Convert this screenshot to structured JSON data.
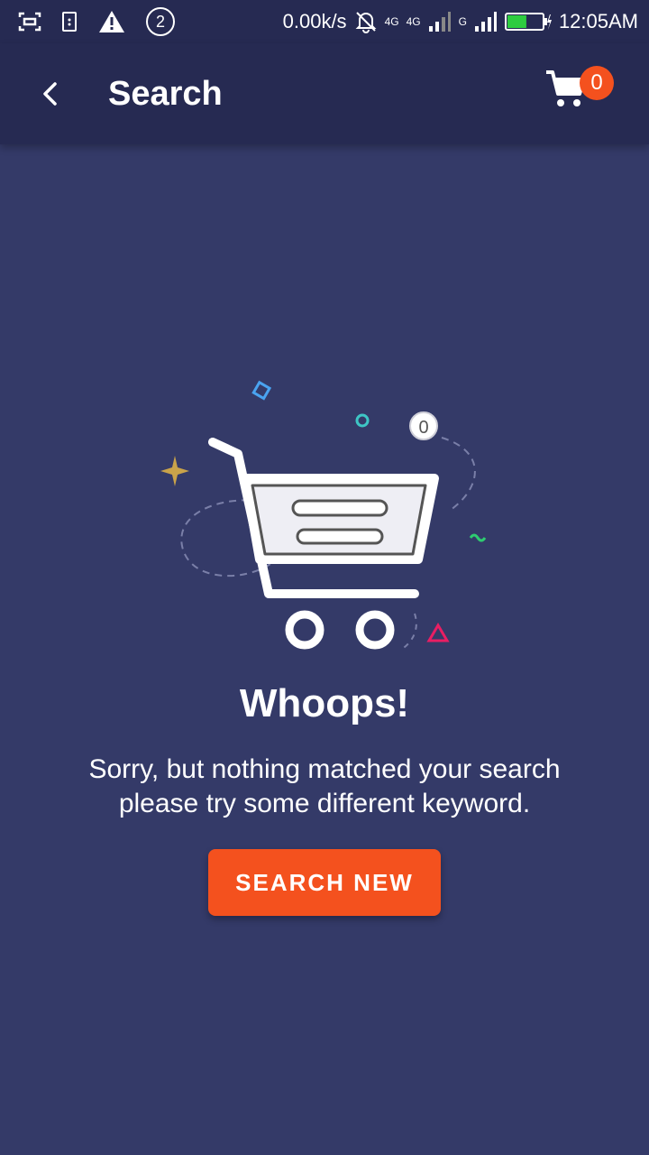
{
  "status_bar": {
    "network_speed": "0.00k/s",
    "notification_count": "2",
    "net_label_1": "4G",
    "net_label_2": "4G",
    "net_label_3": "G",
    "time": "12:05AM",
    "battery_level": 0.55
  },
  "app_bar": {
    "title": "Search",
    "cart_count": "0"
  },
  "illustration": {
    "coin_label": "0"
  },
  "empty_state": {
    "headline": "Whoops!",
    "message_line1": "Sorry, but nothing matched your search",
    "message_line2": "please try some different keyword.",
    "button_label": "SEARCH NEW"
  },
  "colors": {
    "background": "#343a68",
    "app_bar": "#262a52",
    "accent": "#f4511e"
  }
}
